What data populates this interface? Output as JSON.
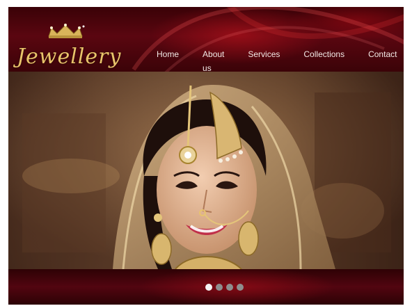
{
  "brand": {
    "logo_text": "Jewellery"
  },
  "nav": {
    "items": [
      {
        "label": "Home"
      },
      {
        "label": "About us"
      },
      {
        "label": "Services"
      },
      {
        "label": "Collections"
      },
      {
        "label": "Contact"
      }
    ]
  },
  "slider": {
    "total_slides": 4,
    "active_slide": 1
  },
  "colors": {
    "header_red": "#5a0610",
    "gold": "#e9c46a",
    "nav_text": "#f2e9e6",
    "dot_active": "#f4f4f4",
    "dot_inactive": "#8e8e8e"
  },
  "icons": [
    "crown-icon"
  ]
}
